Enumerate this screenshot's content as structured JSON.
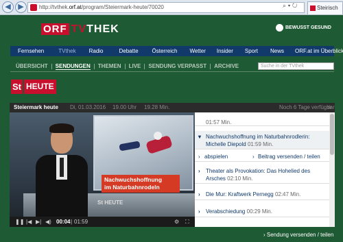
{
  "browser": {
    "url_prefix": "http://tvthek.",
    "url_domain": "orf.at",
    "url_path": "/program/Steiermark-heute/70020",
    "tab_label": "Steirisch"
  },
  "header": {
    "logo_orf": "ORF",
    "logo_tv": "TV",
    "logo_thek": "THEK",
    "bewusst": "BEWUSST GESUND"
  },
  "mainnav": [
    "Fernsehen",
    "TVthek",
    "Radio",
    "Debatte",
    "Österreich",
    "Wetter",
    "Insider",
    "Sport",
    "News",
    "ORF.at im Überblick"
  ],
  "subnav": [
    "ÜBERSICHT",
    "SENDUNGEN",
    "THEMEN",
    "LIVE",
    "SENDUNG VERPASST",
    "ARCHIVE"
  ],
  "search_placeholder": "Suche in der TVthek",
  "show_logo": {
    "st": "St",
    "word": "HEUTE"
  },
  "player": {
    "title": "Steiermark heute",
    "date": "Di, 01.03.2016",
    "start": "19.00 Uhr",
    "end": "19.28 Min.",
    "availability": "Noch 6 Tage verfügbar"
  },
  "video": {
    "banner_line1": "Nachwuchshoffnung",
    "banner_line2": "im Naturbahnrodeln",
    "bug": "St HEUTE"
  },
  "controls": {
    "current": "00:04",
    "separator": "|",
    "duration": "01:59"
  },
  "playlist": [
    {
      "title": "",
      "duration": "01:57 Min."
    },
    {
      "title": "Nachwuchshoffnung im Naturbahnrodlerin: Michelle Diepold",
      "duration": "01:59 Min."
    },
    {
      "title": "Theater als Provokation: Das Hohelied des Arsches",
      "duration": "02:10 Min."
    },
    {
      "title": "Die Mur: Kraftwerk Pernegg",
      "duration": "02:47 Min."
    },
    {
      "title": "Verabschiedung",
      "duration": "00:29 Min."
    }
  ],
  "playlist_actions": {
    "play": "abspielen",
    "share": "Beitrag versenden / teilen"
  },
  "footer_share": "Sendung versenden / teilen"
}
